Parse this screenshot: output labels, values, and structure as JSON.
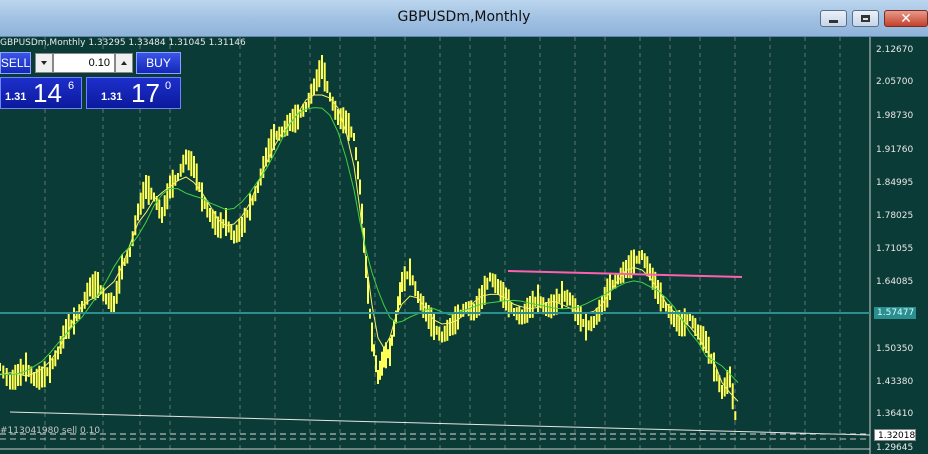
{
  "window": {
    "title": "GBPUSDm,Monthly"
  },
  "chart_header": {
    "symbol_info": "GBPUSDm,Monthly  1.33295 1.33484 1.31045 1.31146"
  },
  "trade_panel": {
    "sell_label": "SELL",
    "buy_label": "BUY",
    "lot_value": "0.10",
    "sell_price": {
      "prefix": "1.31",
      "big": "14",
      "sup": "6"
    },
    "buy_price": {
      "prefix": "1.31",
      "big": "17",
      "sup": "0"
    }
  },
  "price_axis": {
    "labels": [
      "2.12670",
      "2.05700",
      "1.98730",
      "1.91760",
      "1.84995",
      "1.78025",
      "1.71055",
      "1.64085",
      "1.50350",
      "1.43380",
      "1.36410",
      "1.29645"
    ],
    "hline_value": "1.57477",
    "bid_value": "1.32018"
  },
  "order_line": {
    "label": "#113041980 sell 0.10"
  },
  "colors": {
    "chart_bg": "#0b3b36",
    "candles": "#ffff55",
    "ma_fast": "#f2f26a",
    "ma_slow": "#3fd23f",
    "resistance_line": "#ff5fb0",
    "horizontal_line": "#2b8f8f"
  }
}
